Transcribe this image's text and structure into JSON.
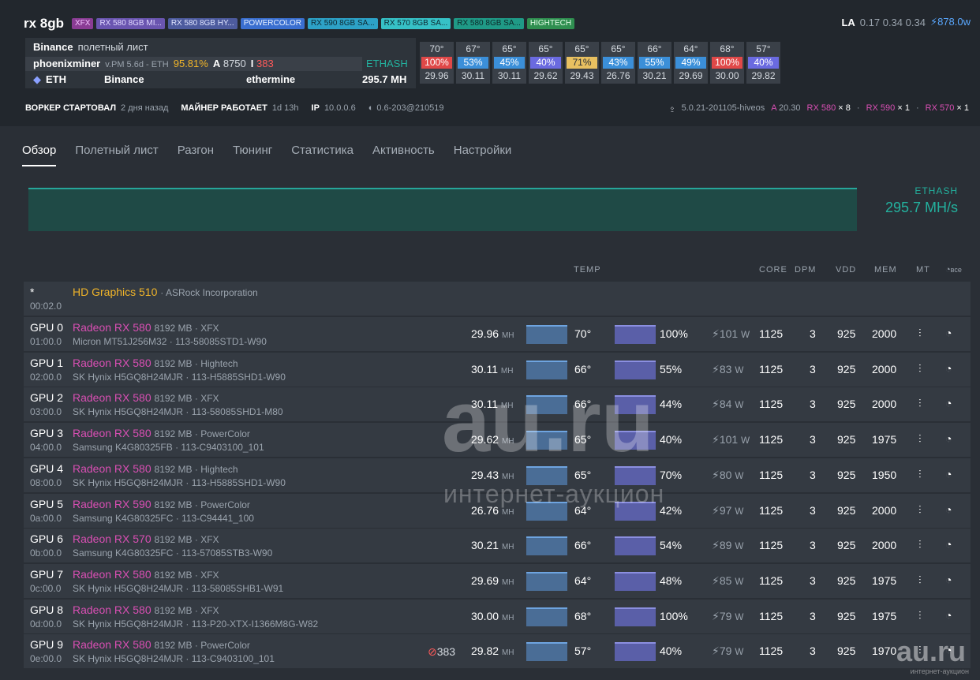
{
  "rig": {
    "title": "rx 8gb"
  },
  "tags": [
    {
      "label": "XFX",
      "bg": "#8a3c94",
      "fg": "#f3c4ff"
    },
    {
      "label": "RX 580 8GB MI...",
      "bg": "#6a55b0",
      "fg": "#e0d8ff"
    },
    {
      "label": "RX 580 8GB HY...",
      "bg": "#4d5b9e",
      "fg": "#dfe4ff"
    },
    {
      "label": "POWERCOLOR",
      "bg": "#3a6fd0",
      "fg": "#e6f0ff"
    },
    {
      "label": "RX 590 8GB SA...",
      "bg": "#2da2c7",
      "fg": "#0d2a33"
    },
    {
      "label": "RX 570 8GB SA...",
      "bg": "#36c1c6",
      "fg": "#0d2a33"
    },
    {
      "label": "RX 580 8GB SA...",
      "bg": "#1f9a86",
      "fg": "#0d2a2a"
    },
    {
      "label": "HIGHTECH",
      "bg": "#2f8f50",
      "fg": "#e4ffe9"
    }
  ],
  "load": {
    "label": "LA",
    "values": "0.17 0.34 0.34",
    "power": "878.0w"
  },
  "miner": {
    "flightsheet_name": "Binance",
    "flightsheet_label": "полетный лист",
    "name": "phoenixminer",
    "version": "v.PM 5.6d - ETH",
    "ratio": "95.81%",
    "accepted_label": "A",
    "accepted": "8750",
    "invalid_label": "I",
    "invalid": "383",
    "algo": "ETHASH",
    "coin": "ETH",
    "wallet": "Binance",
    "pool": "ethermine",
    "hashrate": "295.7 MH"
  },
  "gpu_mini": [
    {
      "temp": "70°",
      "fan": "100%",
      "fan_color": "#e04848",
      "hash": "29.96"
    },
    {
      "temp": "67°",
      "fan": "53%",
      "fan_color": "#3b8fd9",
      "hash": "30.11"
    },
    {
      "temp": "65°",
      "fan": "45%",
      "fan_color": "#3b8fd9",
      "hash": "30.11"
    },
    {
      "temp": "65°",
      "fan": "40%",
      "fan_color": "#6a6ae0",
      "hash": "29.62"
    },
    {
      "temp": "65°",
      "fan": "71%",
      "fan_color": "#e8c060",
      "hash": "29.43"
    },
    {
      "temp": "65°",
      "fan": "43%",
      "fan_color": "#3b8fd9",
      "hash": "26.76"
    },
    {
      "temp": "66°",
      "fan": "55%",
      "fan_color": "#3b8fd9",
      "hash": "30.21"
    },
    {
      "temp": "64°",
      "fan": "49%",
      "fan_color": "#3b8fd9",
      "hash": "29.69"
    },
    {
      "temp": "68°",
      "fan": "100%",
      "fan_color": "#e04848",
      "hash": "30.00"
    },
    {
      "temp": "57°",
      "fan": "40%",
      "fan_color": "#6a6ae0",
      "hash": "29.82"
    }
  ],
  "status": {
    "started_label": "ВОРКЕР СТАРТОВАЛ",
    "started": "2 дня назад",
    "uptime_label": "МАЙНЕР РАБОТАЕТ",
    "uptime": "1d 13h",
    "ip_label": "IP",
    "ip": "10.0.0.6",
    "version": "0.6-203@210519",
    "kernel": "5.0.21-201105-hiveos",
    "amd_label": "A",
    "amd": "20.30",
    "rx580": "RX 580",
    "rx580_count": "× 8",
    "rx590": "RX 590",
    "rx590_count": "× 1",
    "rx570": "RX 570",
    "rx570_count": "× 1",
    "dot": "·"
  },
  "tabs": [
    "Обзор",
    "Полетный лист",
    "Разгон",
    "Тюнинг",
    "Статистика",
    "Активность",
    "Настройки"
  ],
  "hashrate_panel": {
    "algo": "ETHASH",
    "value": "295.7 MH/s"
  },
  "columns": {
    "temp": "TEMP",
    "core": "CORE",
    "dpm": "DPM",
    "vdd": "VDD",
    "mem": "MEM",
    "mt": "MT",
    "all": "все"
  },
  "igpu": {
    "id": "*",
    "bus": "00:02.0",
    "name": "HD Graphics 510",
    "vendor": "· ASRock Incorporation"
  },
  "units": {
    "mh": "MH",
    "w": "W"
  },
  "gpus": [
    {
      "id": "GPU 0",
      "bus": "01:00.0",
      "model": "Radeon RX 580",
      "spec": "8192 MB · XFX",
      "mem": "Micron MT51J256M32 · 113-58085STD1-W90",
      "rejects": "",
      "hash": "29.96",
      "temp": "70°",
      "fan": "100%",
      "power": "101",
      "core": "1125",
      "dpm": "3",
      "vdd": "925",
      "memclk": "2000"
    },
    {
      "id": "GPU 1",
      "bus": "02:00.0",
      "model": "Radeon RX 580",
      "spec": "8192 MB · Hightech",
      "mem": "SK Hynix H5GQ8H24MJR · 113-H5885SHD1-W90",
      "rejects": "",
      "hash": "30.11",
      "temp": "66°",
      "fan": "55%",
      "power": "83",
      "core": "1125",
      "dpm": "3",
      "vdd": "925",
      "memclk": "2000"
    },
    {
      "id": "GPU 2",
      "bus": "03:00.0",
      "model": "Radeon RX 580",
      "spec": "8192 MB · XFX",
      "mem": "SK Hynix H5GQ8H24MJR · 113-58085SHD1-M80",
      "rejects": "",
      "hash": "30.11",
      "temp": "66°",
      "fan": "44%",
      "power": "84",
      "core": "1125",
      "dpm": "3",
      "vdd": "925",
      "memclk": "2000"
    },
    {
      "id": "GPU 3",
      "bus": "04:00.0",
      "model": "Radeon RX 580",
      "spec": "8192 MB · PowerColor",
      "mem": "Samsung K4G80325FB · 113-C9403100_101",
      "rejects": "",
      "hash": "29.62",
      "temp": "65°",
      "fan": "40%",
      "power": "101",
      "core": "1125",
      "dpm": "3",
      "vdd": "925",
      "memclk": "1975"
    },
    {
      "id": "GPU 4",
      "bus": "08:00.0",
      "model": "Radeon RX 580",
      "spec": "8192 MB · Hightech",
      "mem": "SK Hynix H5GQ8H24MJR · 113-H5885SHD1-W90",
      "rejects": "",
      "hash": "29.43",
      "temp": "65°",
      "fan": "70%",
      "power": "80",
      "core": "1125",
      "dpm": "3",
      "vdd": "925",
      "memclk": "1950"
    },
    {
      "id": "GPU 5",
      "bus": "0a:00.0",
      "model": "Radeon RX 590",
      "spec": "8192 MB · PowerColor",
      "mem": "Samsung K4G80325FC · 113-C94441_100",
      "rejects": "",
      "hash": "26.76",
      "temp": "64°",
      "fan": "42%",
      "power": "97",
      "core": "1125",
      "dpm": "3",
      "vdd": "925",
      "memclk": "2000"
    },
    {
      "id": "GPU 6",
      "bus": "0b:00.0",
      "model": "Radeon RX 570",
      "spec": "8192 MB · XFX",
      "mem": "Samsung K4G80325FC · 113-57085STB3-W90",
      "rejects": "",
      "hash": "30.21",
      "temp": "66°",
      "fan": "54%",
      "power": "89",
      "core": "1125",
      "dpm": "3",
      "vdd": "925",
      "memclk": "2000"
    },
    {
      "id": "GPU 7",
      "bus": "0c:00.0",
      "model": "Radeon RX 580",
      "spec": "8192 MB · XFX",
      "mem": "SK Hynix H5GQ8H24MJR · 113-58085SHB1-W91",
      "rejects": "",
      "hash": "29.69",
      "temp": "64°",
      "fan": "48%",
      "power": "85",
      "core": "1125",
      "dpm": "3",
      "vdd": "925",
      "memclk": "1975"
    },
    {
      "id": "GPU 8",
      "bus": "0d:00.0",
      "model": "Radeon RX 580",
      "spec": "8192 MB · XFX",
      "mem": "SK Hynix H5GQ8H24MJR · 113-P20-XTX-I1366M8G-W82",
      "rejects": "",
      "hash": "30.00",
      "temp": "68°",
      "fan": "100%",
      "power": "79",
      "core": "1125",
      "dpm": "3",
      "vdd": "925",
      "memclk": "1975"
    },
    {
      "id": "GPU 9",
      "bus": "0e:00.0",
      "model": "Radeon RX 580",
      "spec": "8192 MB · PowerColor",
      "mem": "SK Hynix H5GQ8H24MJR · 113-C9403100_101",
      "rejects": "383",
      "hash": "29.82",
      "temp": "57°",
      "fan": "40%",
      "power": "79",
      "core": "1125",
      "dpm": "3",
      "vdd": "925",
      "memclk": "1970"
    }
  ],
  "watermark": {
    "main": "au.ru",
    "sub": "интернет-аукцион",
    "corner": "au.ru",
    "corner_sub": "интернет-аукцион"
  }
}
